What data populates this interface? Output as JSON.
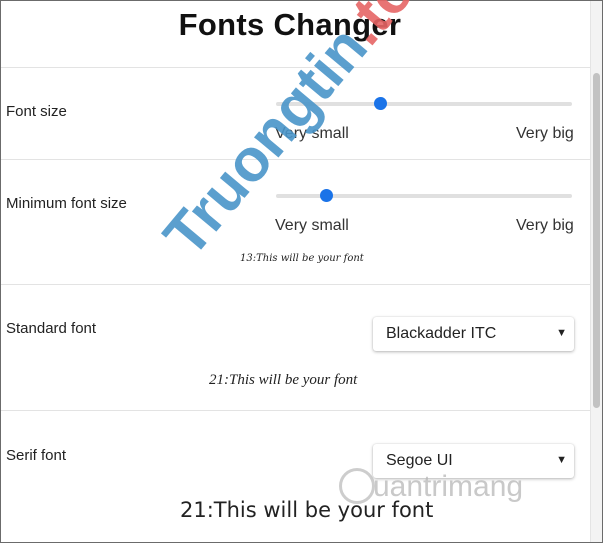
{
  "app": {
    "title": "Fonts Changer"
  },
  "font_size": {
    "label": "Font size",
    "min_label": "Very small",
    "max_label": "Very big",
    "value_fraction": 0.35
  },
  "min_font_size": {
    "label": "Minimum font size",
    "min_label": "Very small",
    "max_label": "Very big",
    "value_fraction": 0.17,
    "preview_text": "13:This will be your font"
  },
  "standard_font": {
    "label": "Standard font",
    "selected": "Blackadder ITC",
    "preview_text": "21:This will be your font"
  },
  "serif_font": {
    "label": "Serif font",
    "selected": "Segoe UI",
    "preview_text": "21:This will be your font"
  },
  "watermarks": {
    "left_blue": "Truongtin",
    "left_red": ".top",
    "right": "uantrimang"
  },
  "colors": {
    "slider_thumb": "#1a73e8",
    "slider_track": "#e0e0e0",
    "divider": "#e3e3e3"
  }
}
